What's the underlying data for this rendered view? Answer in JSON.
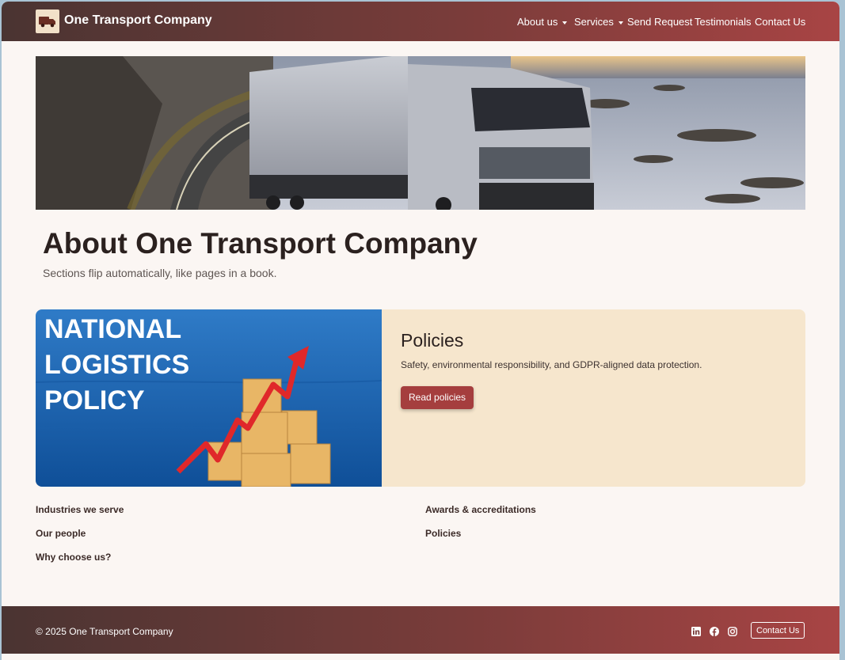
{
  "brand": {
    "name": "One Transport Company",
    "logo_icon": "truck-icon"
  },
  "nav": {
    "items": [
      {
        "label": "About us",
        "dropdown": true
      },
      {
        "label": "Services",
        "dropdown": true
      },
      {
        "label": "Send Request",
        "dropdown": false
      },
      {
        "label": "Testimonials",
        "dropdown": false
      },
      {
        "label": "Contact Us",
        "dropdown": false
      }
    ]
  },
  "page": {
    "title": "About One Transport Company",
    "subtitle": "Sections flip automatically, like pages in a book."
  },
  "feature": {
    "image_text": [
      "NATIONAL",
      "LOGISTICS",
      "POLICY"
    ],
    "title": "Policies",
    "text": "Safety, environmental responsibility, and GDPR-aligned data protection.",
    "button": "Read policies"
  },
  "sections": {
    "left": [
      "Industries we serve",
      "Our people",
      "Why choose us?"
    ],
    "right": [
      "Awards & accreditations",
      "Policies"
    ]
  },
  "footer": {
    "copyright": "© 2025 One Transport Company",
    "social": [
      "linkedin-icon",
      "facebook-icon",
      "instagram-icon"
    ],
    "contact_button": "Contact Us"
  },
  "colors": {
    "nav_gradient_start": "#4a3432",
    "nav_gradient_end": "#a84444",
    "accent": "#a53e3e",
    "card_background": "#f6e6cd",
    "page_background": "#fbf6f3"
  }
}
